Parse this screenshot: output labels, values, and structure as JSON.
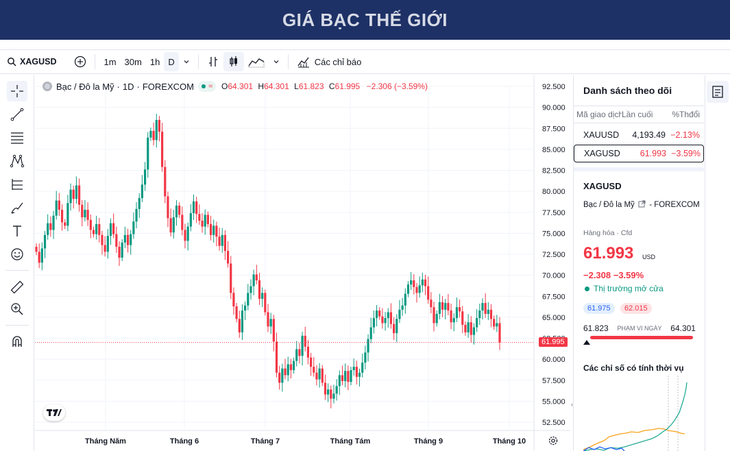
{
  "page": {
    "title": "GIÁ BẠC THẾ GIỚI"
  },
  "toolbar": {
    "symbol": "XAGUSD",
    "intervals": [
      "1m",
      "30m",
      "1h",
      "D"
    ],
    "indicators_label": "Các chỉ báo"
  },
  "legend": {
    "name": "Bạc / Đô la Mỹ",
    "interval": "1D",
    "exchange": "FOREXCOM",
    "o_label": "O",
    "o": "64.301",
    "h_label": "H",
    "h": "64.301",
    "l_label": "L",
    "l": "61.823",
    "c_label": "C",
    "c": "61.995",
    "change": "−2.306 (−3.59%)"
  },
  "last_price_tag": "61.995",
  "chart_data": {
    "type": "candlestick",
    "y_ticks": [
      "92.500",
      "90.000",
      "87.500",
      "85.000",
      "82.500",
      "80.000",
      "77.500",
      "75.000",
      "72.500",
      "70.000",
      "67.500",
      "65.000",
      "62.500",
      "60.000",
      "57.500",
      "55.000",
      "52.500"
    ],
    "ylim": [
      52.5,
      92.5
    ],
    "x_ticks": [
      "Tháng Năm",
      "Tháng 6",
      "Tháng 7",
      "Tháng Tám",
      "Tháng 9",
      "Tháng 10"
    ],
    "closes": [
      72.8,
      71.5,
      73.2,
      74.8,
      76.2,
      75.4,
      77.1,
      78.9,
      77.8,
      76.3,
      75.9,
      78.6,
      80.2,
      79.1,
      80.7,
      78.4,
      76.9,
      77.8,
      76.6,
      75.4,
      74.9,
      76.1,
      74.8,
      73.6,
      72.8,
      74.7,
      76.2,
      74.9,
      73.4,
      72.1,
      73.9,
      74.8,
      73.6,
      74.9,
      76.4,
      77.9,
      79.2,
      80.8,
      82.6,
      86.4,
      87.2,
      86.1,
      88.5,
      87.1,
      82.9,
      79.4,
      76.8,
      75.1,
      76.9,
      78.3,
      77.2,
      75.4,
      74.1,
      75.8,
      77.4,
      78.8,
      77.3,
      76.5,
      75.8,
      77.2,
      76.1,
      74.8,
      75.9,
      74.6,
      73.5,
      74.8,
      72.9,
      71.4,
      67.9,
      66.3,
      64.8,
      63.2,
      65.8,
      66.4,
      67.9,
      68.7,
      70.1,
      69.4,
      67.2,
      67.9,
      65.6,
      63.9,
      64.8,
      62.1,
      58.4,
      57.2,
      58.9,
      58.1,
      59.4,
      58.7,
      59.8,
      61.2,
      60.4,
      62.8,
      61.5,
      60.2,
      59.1,
      58.4,
      57.6,
      58.9,
      57.2,
      55.8,
      56.4,
      55.3,
      55.9,
      56.8,
      58.1,
      57.4,
      58.6,
      57.3,
      58.7,
      59.1,
      57.9,
      58.4,
      59.6,
      60.8,
      62.4,
      63.8,
      64.9,
      65.8,
      65.1,
      64.3,
      64.9,
      65.6,
      64.2,
      63.1,
      64.8,
      65.9,
      66.4,
      67.8,
      68.9,
      69.4,
      68.6,
      67.9,
      68.8,
      69.5,
      68.7,
      67.1,
      66.2,
      64.3,
      65.4,
      66.8,
      65.9,
      66.7,
      65.8,
      64.4,
      64.9,
      66.2,
      65.7,
      64.1,
      63.2,
      64.4,
      62.9,
      63.8,
      64.9,
      65.8,
      66.7,
      65.4,
      65.9,
      64.8,
      63.9,
      64.3,
      61.995
    ]
  },
  "watchlist": {
    "title": "Danh sách theo dõi",
    "headers": [
      "Mã giao dịch",
      "Lần cuối",
      "%Thđổi"
    ],
    "rows": [
      {
        "symbol": "XAUUSD",
        "last": "4,193.49",
        "chg": "−2.13%"
      },
      {
        "symbol": "XAGUSD",
        "last": "61.993",
        "chg": "−3.59%"
      }
    ]
  },
  "detail": {
    "symbol": "XAGUSD",
    "name": "Bạc / Đô la Mỹ",
    "exchange": "- FOREXCOM",
    "category": "Hàng hóa · Cfd",
    "price": "61.993",
    "currency": "USD",
    "change": "−2.308  −3.59%",
    "market_status": "Thị trường mở cửa",
    "bid": "61.975",
    "ask": "62.015",
    "day_low": "61.823",
    "day_range_label": "PHẠM VI NGÀY",
    "day_high": "64.301",
    "seasonals_title": "Các chỉ số có tính thời vụ"
  },
  "colors": {
    "up": "#089981",
    "down": "#f23645",
    "banner": "#1e3166"
  }
}
